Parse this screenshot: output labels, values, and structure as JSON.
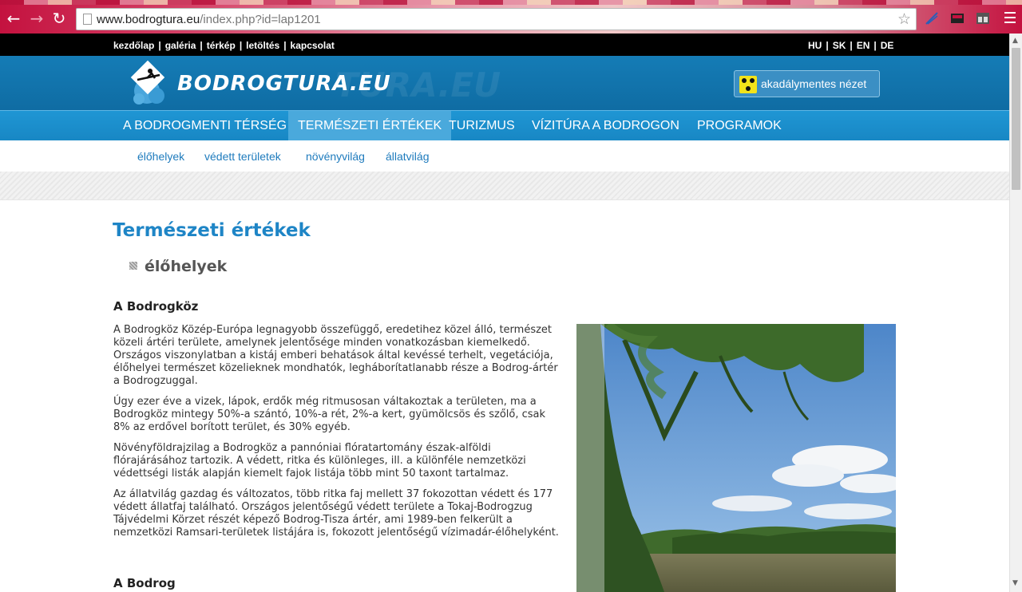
{
  "browser": {
    "url_domain": "www.bodrogtura.eu",
    "url_path": "/index.php?id=lap1201"
  },
  "site": {
    "toplinks": [
      "kezdőlap",
      "galéria",
      "térkép",
      "letöltés",
      "kapcsolat"
    ],
    "languages": [
      "HU",
      "SK",
      "EN",
      "DE"
    ],
    "logo_text": "BODROGTURA.EU",
    "logo_ghost": "TURA.EU",
    "accessible_view_label": "akadálymentes nézet",
    "main_nav": [
      {
        "label": "A BODROGMENTI TÉRSÉG",
        "active": false
      },
      {
        "label": "TERMÉSZETI ÉRTÉKEK",
        "active": true
      },
      {
        "label": "TURIZMUS",
        "active": false
      },
      {
        "label": "VÍZITÚRA A BODROGON",
        "active": false
      },
      {
        "label": "PROGRAMOK",
        "active": false
      }
    ],
    "sub_nav": [
      "élőhelyek",
      "védett területek",
      "növényvilág",
      "állatvilág"
    ]
  },
  "content": {
    "page_title": "Természeti értékek",
    "section_title": "élőhelyek",
    "heading_1": "A Bodrogköz",
    "paragraphs": [
      "A Bodrogköz Közép-Európa legnagyobb összefüggő, eredetihez közel álló, természet közeli ártéri területe, amelynek jelentősége minden vonatkozásban kiemelkedő. Országos viszonylatban a kistáj emberi behatások által kevéssé terhelt, vegetációja, élőhelyei természet közelieknek mondhatók, legháborítatlanabb része a Bodrog-ártér a Bodrogzuggal.",
      "Úgy ezer éve a vizek, lápok, erdők még ritmusosan váltakoztak a területen, ma a Bodrogköz mintegy 50%-a szántó, 10%-a rét, 2%-a kert, gyümölcsös és szőlő, csak 8% az erdővel borított terület, és 30% egyéb.",
      "Növényföldrajzilag a Bodrogköz a pannóniai flóratartomány észak-alföldi flórajárásához tartozik. A védett, ritka és különleges, ill. a különféle nemzetközi védettségi listák alapján kiemelt fajok listája több mint 50 taxont tartalmaz.",
      "Az állatvilág gazdag és változatos, több ritka faj mellett 37 fokozottan védett és 177 védett állatfaj található. Országos jelentőségű védett területe a Tokaj-Bodrogzug Tájvédelmi Körzet részét képező Bodrog-Tisza ártér, ami 1989-ben felkerült a nemzetközi Ramsari-területek listájára is, fokozott jelentőségű vízimadár-élőhelyként."
    ],
    "heading_2": "A Bodrog"
  },
  "colors": {
    "header_blue": "#157cb6",
    "nav_blue": "#1f96d4",
    "title_blue": "#1e85c6"
  }
}
